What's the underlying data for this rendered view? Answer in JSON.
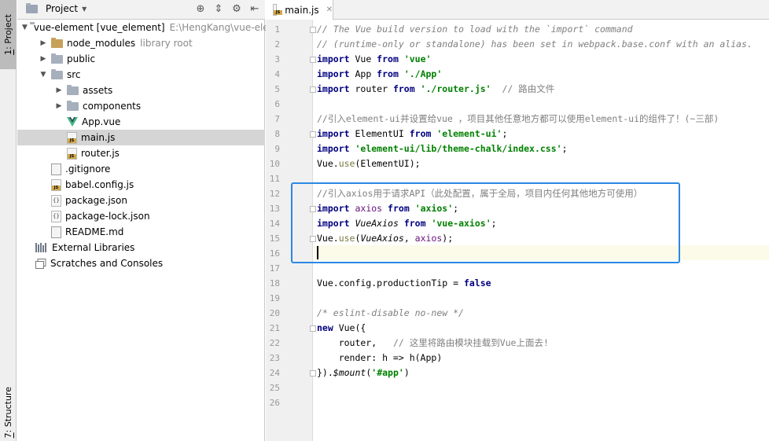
{
  "tool_strip": {
    "project_tab_mnemonic": "1",
    "project_tab_label": ": Project",
    "structure_tab_mnemonic": "7",
    "structure_tab_label": ": Structure"
  },
  "panel": {
    "title": "Project",
    "icons": [
      "crosshair-icon",
      "collapse-icon",
      "gear-icon",
      "hide-icon"
    ]
  },
  "tree": [
    {
      "label": "vue-element [vue_element]",
      "hint": "E:\\HengKang\\vue-elem",
      "depth": 0,
      "arrow": "down",
      "icon": "folder"
    },
    {
      "label": "node_modules",
      "hint": "library root",
      "depth": 1,
      "arrow": "right",
      "icon": "folder-orange"
    },
    {
      "label": "public",
      "hint": "",
      "depth": 1,
      "arrow": "right",
      "icon": "folder"
    },
    {
      "label": "src",
      "hint": "",
      "depth": 1,
      "arrow": "down",
      "icon": "folder"
    },
    {
      "label": "assets",
      "hint": "",
      "depth": 2,
      "arrow": "right",
      "icon": "folder"
    },
    {
      "label": "components",
      "hint": "",
      "depth": 2,
      "arrow": "right",
      "icon": "folder"
    },
    {
      "label": "App.vue",
      "hint": "",
      "depth": 2,
      "arrow": "none",
      "icon": "vue"
    },
    {
      "label": "main.js",
      "hint": "",
      "depth": 2,
      "arrow": "none",
      "icon": "js",
      "selected": true
    },
    {
      "label": "router.js",
      "hint": "",
      "depth": 2,
      "arrow": "none",
      "icon": "js"
    },
    {
      "label": ".gitignore",
      "hint": "",
      "depth": 1,
      "arrow": "none",
      "icon": "file"
    },
    {
      "label": "babel.config.js",
      "hint": "",
      "depth": 1,
      "arrow": "none",
      "icon": "js"
    },
    {
      "label": "package.json",
      "hint": "",
      "depth": 1,
      "arrow": "none",
      "icon": "json"
    },
    {
      "label": "package-lock.json",
      "hint": "",
      "depth": 1,
      "arrow": "none",
      "icon": "json"
    },
    {
      "label": "README.md",
      "hint": "",
      "depth": 1,
      "arrow": "none",
      "icon": "file"
    },
    {
      "label": "External Libraries",
      "hint": "",
      "depth": 0,
      "arrow": "none",
      "icon": "lib"
    },
    {
      "label": "Scratches and Consoles",
      "hint": "",
      "depth": 0,
      "arrow": "none",
      "icon": "scratch"
    }
  ],
  "editor": {
    "tab_label": "main.js",
    "current_line": 16,
    "lines": [
      [
        [
          "cm",
          "// The Vue build version to load with the `import` command"
        ]
      ],
      [
        [
          "cm",
          "// (runtime-only or standalone) has been set in webpack.base.conf with an alias."
        ]
      ],
      [
        [
          "kw",
          "import"
        ],
        [
          "t",
          " Vue "
        ],
        [
          "kw",
          "from"
        ],
        [
          "t",
          " "
        ],
        [
          "str",
          "'vue'"
        ]
      ],
      [
        [
          "kw",
          "import"
        ],
        [
          "t",
          " App "
        ],
        [
          "kw",
          "from"
        ],
        [
          "t",
          " "
        ],
        [
          "str",
          "'./App'"
        ]
      ],
      [
        [
          "kw",
          "import"
        ],
        [
          "t",
          " router "
        ],
        [
          "kw",
          "from"
        ],
        [
          "t",
          " "
        ],
        [
          "str",
          "'./router.js'"
        ],
        [
          "t",
          "  "
        ],
        [
          "cmn",
          "// 路由文件"
        ]
      ],
      [],
      [
        [
          "cmn",
          "//引入element-ui并设置给vue ，项目其他任意地方都可以使用element-ui的组件了！(~三部)"
        ]
      ],
      [
        [
          "kw",
          "import"
        ],
        [
          "t",
          " ElementUI "
        ],
        [
          "kw",
          "from"
        ],
        [
          "t",
          " "
        ],
        [
          "str",
          "'element-ui'"
        ],
        [
          "t",
          ";"
        ]
      ],
      [
        [
          "kw",
          "import"
        ],
        [
          "t",
          " "
        ],
        [
          "str",
          "'element-ui/lib/theme-chalk/index.css'"
        ],
        [
          "t",
          ";"
        ]
      ],
      [
        [
          "t",
          "Vue."
        ],
        [
          "fn",
          "use"
        ],
        [
          "t",
          "(ElementUI);"
        ]
      ],
      [],
      [
        [
          "cmn",
          "//引入axios用于请求API（此处配置，属于全局，项目内任何其他地方可使用）"
        ]
      ],
      [
        [
          "kw",
          "import"
        ],
        [
          "t",
          " "
        ],
        [
          "prop",
          "axios"
        ],
        [
          "t",
          " "
        ],
        [
          "kw",
          "from"
        ],
        [
          "t",
          " "
        ],
        [
          "str",
          "'axios'"
        ],
        [
          "t",
          ";"
        ]
      ],
      [
        [
          "kw",
          "import"
        ],
        [
          "t",
          " "
        ],
        [
          "it",
          "VueAxios"
        ],
        [
          "t",
          " "
        ],
        [
          "kw",
          "from"
        ],
        [
          "t",
          " "
        ],
        [
          "str",
          "'vue-axios'"
        ],
        [
          "t",
          ";"
        ]
      ],
      [
        [
          "t",
          "Vue."
        ],
        [
          "fn",
          "use"
        ],
        [
          "t",
          "("
        ],
        [
          "it",
          "VueAxios"
        ],
        [
          "t",
          ", "
        ],
        [
          "prop",
          "axios"
        ],
        [
          "t",
          ");"
        ]
      ],
      [],
      [],
      [
        [
          "t",
          "Vue.config.productionTip = "
        ],
        [
          "kw",
          "false"
        ]
      ],
      [],
      [
        [
          "cm",
          "/* eslint-disable no-new */"
        ]
      ],
      [
        [
          "kw",
          "new"
        ],
        [
          "t",
          " Vue({"
        ]
      ],
      [
        [
          "t",
          "    router,   "
        ],
        [
          "cmn",
          "// 这里将路由模块挂载到Vue上面去!"
        ]
      ],
      [
        [
          "t",
          "    render: h => h(App)"
        ]
      ],
      [
        [
          "t",
          "})."
        ],
        [
          "it",
          "$mount"
        ],
        [
          "t",
          "("
        ],
        [
          "str",
          "'#app'"
        ],
        [
          "t",
          ")"
        ]
      ],
      [],
      []
    ]
  }
}
